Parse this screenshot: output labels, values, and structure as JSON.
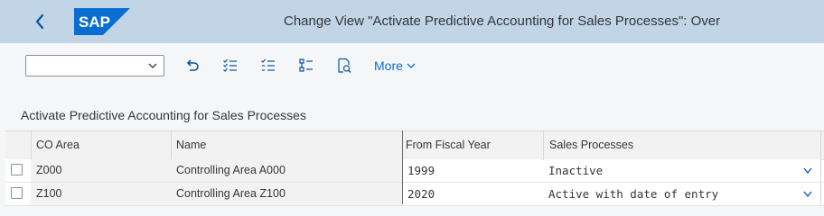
{
  "shell": {
    "title": "Change View \"Activate Predictive Accounting for Sales Processes\": Over",
    "logo_text": "SAP",
    "back_icon": "chevron-left-icon"
  },
  "toolbar": {
    "variant_value": "",
    "icons": [
      "undo-icon",
      "select-all-icon",
      "deselect-all-icon",
      "list-details-icon",
      "print-preview-icon"
    ],
    "more_label": "More"
  },
  "table": {
    "title": "Activate Predictive Accounting for Sales Processes",
    "columns": [
      "CO Area",
      "Name",
      "From Fiscal Year",
      "Sales Processes"
    ],
    "rows": [
      {
        "co_area": "Z000",
        "name": "Controlling Area A000",
        "from_fiscal_year": "1999",
        "sales_processes": "Inactive"
      },
      {
        "co_area": "Z100",
        "name": "Controlling Area Z100",
        "from_fiscal_year": "2020",
        "sales_processes": "Active with date of entry"
      }
    ]
  },
  "colors": {
    "shell_bg": "#c1d5e6",
    "logo_blue": "#0a6ed1",
    "link": "#0a6ed1",
    "page_bg": "#f5f6f7"
  }
}
